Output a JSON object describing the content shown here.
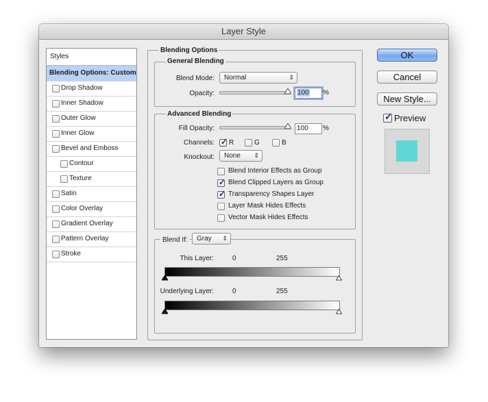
{
  "window": {
    "title": "Layer Style"
  },
  "styles_panel": {
    "header": "Styles",
    "items": [
      {
        "label": "Blending Options: Custom",
        "selected": true,
        "has_checkbox": false,
        "indent": false
      },
      {
        "label": "Drop Shadow",
        "has_checkbox": true,
        "checked": false,
        "indent": false
      },
      {
        "label": "Inner Shadow",
        "has_checkbox": true,
        "checked": false,
        "indent": false
      },
      {
        "label": "Outer Glow",
        "has_checkbox": true,
        "checked": false,
        "indent": false
      },
      {
        "label": "Inner Glow",
        "has_checkbox": true,
        "checked": false,
        "indent": false
      },
      {
        "label": "Bevel and Emboss",
        "has_checkbox": true,
        "checked": false,
        "indent": false
      },
      {
        "label": "Contour",
        "has_checkbox": true,
        "checked": false,
        "indent": true
      },
      {
        "label": "Texture",
        "has_checkbox": true,
        "checked": false,
        "indent": true
      },
      {
        "label": "Satin",
        "has_checkbox": true,
        "checked": false,
        "indent": false
      },
      {
        "label": "Color Overlay",
        "has_checkbox": true,
        "checked": false,
        "indent": false
      },
      {
        "label": "Gradient Overlay",
        "has_checkbox": true,
        "checked": false,
        "indent": false
      },
      {
        "label": "Pattern Overlay",
        "has_checkbox": true,
        "checked": false,
        "indent": false
      },
      {
        "label": "Stroke",
        "has_checkbox": true,
        "checked": false,
        "indent": false
      }
    ]
  },
  "blending_options": {
    "title": "Blending Options",
    "general": {
      "title": "General Blending",
      "blend_mode_label": "Blend Mode:",
      "blend_mode_value": "Normal",
      "opacity_label": "Opacity:",
      "opacity_value": "100",
      "opacity_unit": "%",
      "opacity_fraction": 1.0
    },
    "advanced": {
      "title": "Advanced Blending",
      "fill_opacity_label": "Fill Opacity:",
      "fill_opacity_value": "100",
      "fill_opacity_unit": "%",
      "fill_opacity_fraction": 1.0,
      "channels_label": "Channels:",
      "channels": [
        {
          "label": "R",
          "checked": true
        },
        {
          "label": "G",
          "checked": false
        },
        {
          "label": "B",
          "checked": false
        }
      ],
      "knockout_label": "Knockout:",
      "knockout_value": "None",
      "options": [
        {
          "label": "Blend Interior Effects as Group",
          "checked": false
        },
        {
          "label": "Blend Clipped Layers as Group",
          "checked": true
        },
        {
          "label": "Transparency Shapes Layer",
          "checked": true
        },
        {
          "label": "Layer Mask Hides Effects",
          "checked": false
        },
        {
          "label": "Vector Mask Hides Effects",
          "checked": false
        }
      ]
    },
    "blend_if": {
      "label": "Blend If:",
      "value": "Gray",
      "this_layer_label": "This Layer:",
      "this_layer_min": "0",
      "this_layer_max": "255",
      "underlying_label": "Underlying Layer:",
      "underlying_min": "0",
      "underlying_max": "255"
    }
  },
  "buttons": {
    "ok": "OK",
    "cancel": "Cancel",
    "new_style": "New Style...",
    "preview_label": "Preview",
    "preview_checked": true
  },
  "colors": {
    "accent": "#78a8ec",
    "selection": "#b9d3f7",
    "preview_swatch": "#5fd7d7"
  },
  "icons": {
    "popup_arrows": "updown-arrows-icon",
    "checkmark": "checkmark-icon",
    "slider_thumb": "triangle-thumb-icon"
  }
}
